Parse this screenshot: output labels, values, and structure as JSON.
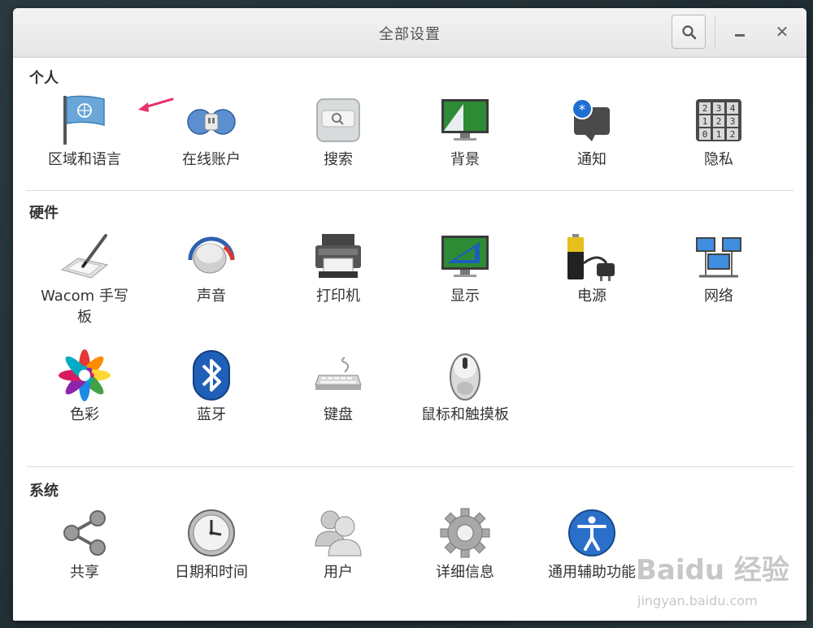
{
  "window": {
    "title": "全部设置"
  },
  "sections": [
    {
      "title": "个人",
      "items": [
        {
          "label": "区域和语言",
          "icon": "flag-icon"
        },
        {
          "label": "在线账户",
          "icon": "online-accounts-icon"
        },
        {
          "label": "搜索",
          "icon": "search-settings-icon"
        },
        {
          "label": "背景",
          "icon": "background-icon"
        },
        {
          "label": "通知",
          "icon": "notification-icon"
        },
        {
          "label": "隐私",
          "icon": "privacy-lock-icon"
        }
      ]
    },
    {
      "title": "硬件",
      "items": [
        {
          "label": "Wacom 手写板",
          "icon": "wacom-tablet-icon"
        },
        {
          "label": "声音",
          "icon": "sound-knob-icon"
        },
        {
          "label": "打印机",
          "icon": "printer-icon"
        },
        {
          "label": "显示",
          "icon": "display-icon"
        },
        {
          "label": "电源",
          "icon": "battery-plug-icon"
        },
        {
          "label": "网络",
          "icon": "network-icon"
        },
        {
          "label": "色彩",
          "icon": "color-flower-icon"
        },
        {
          "label": "蓝牙",
          "icon": "bluetooth-icon"
        },
        {
          "label": "键盘",
          "icon": "keyboard-icon"
        },
        {
          "label": "鼠标和触摸板",
          "icon": "mouse-icon"
        }
      ]
    },
    {
      "title": "系统",
      "items": [
        {
          "label": "共享",
          "icon": "share-icon"
        },
        {
          "label": "日期和时间",
          "icon": "clock-icon"
        },
        {
          "label": "用户",
          "icon": "users-icon"
        },
        {
          "label": "详细信息",
          "icon": "gear-icon"
        },
        {
          "label": "通用辅助功能",
          "icon": "accessibility-icon"
        }
      ]
    }
  ],
  "watermark": {
    "brand": "Baidu 经验",
    "url": "jingyan.baidu.com"
  },
  "colors": {
    "annotation_arrow": "#e8336a",
    "accent_blue": "#2a6fc9"
  }
}
